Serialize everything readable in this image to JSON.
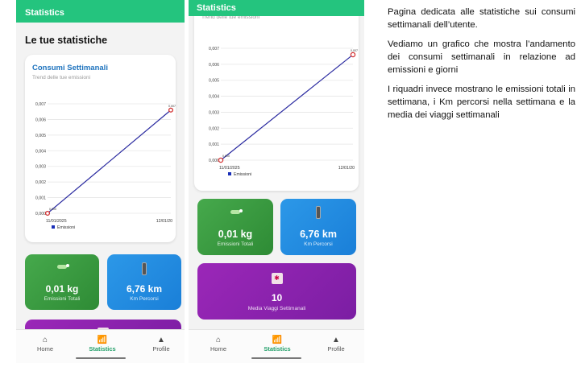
{
  "appbar": {
    "title": "Statistics"
  },
  "page": {
    "title": "Le tue statistiche"
  },
  "chart_card": {
    "title": "Consumi Settimanali",
    "subtitle": "Trend delle tue emissioni"
  },
  "chart_data": {
    "type": "line",
    "x": [
      "11/01/2025",
      "12/01/20"
    ],
    "series": [
      {
        "name": "Emissioni",
        "values": [
          0.0,
          0.0066
        ]
      }
    ],
    "point_labels": [
      "0,000",
      "0,007"
    ],
    "yticks": [
      "0,000",
      "0,001",
      "0,002",
      "0,003",
      "0,004",
      "0,005",
      "0,006",
      "0,007"
    ],
    "ylim": [
      0,
      0.007
    ],
    "legend": "bottom-left",
    "colors": {
      "line": "#2a2aa0",
      "point": "#d32f2f",
      "legend": "#1a2fb8"
    },
    "grid": true
  },
  "tiles": {
    "emissions": {
      "value": "0,01 kg",
      "label": "Emissioni Totali",
      "icon": "leaf-icon"
    },
    "km": {
      "value": "6,76 km",
      "label": "Km Percorsi",
      "icon": "road-icon"
    },
    "trips": {
      "value": "10",
      "label": "Media Viaggi Settimanali",
      "icon": "calendar-icon"
    }
  },
  "nav": [
    {
      "label": "Home",
      "icon": "home-icon"
    },
    {
      "label": "Statistics",
      "icon": "bar-chart-icon"
    },
    {
      "label": "Profile",
      "icon": "person-icon"
    }
  ],
  "description": {
    "p1": "Pagina dedicata alle statistiche sui consumi settimanali dell’utente.",
    "p2": "Vediamo un grafico che mostra l’andamento dei consumi settimanali in relazione ad emissioni e giorni",
    "p3": "I riquadri invece mostrano le emissioni totali in settimana, i Km percorsi nella settimana e la media dei viaggi settimanali"
  },
  "colors": {
    "primary": "#24c47e",
    "accent_blue": "#1e73be",
    "green_tile": "#3a9d41",
    "blue_tile": "#2290e4",
    "purple_tile": "#8a22ad"
  }
}
